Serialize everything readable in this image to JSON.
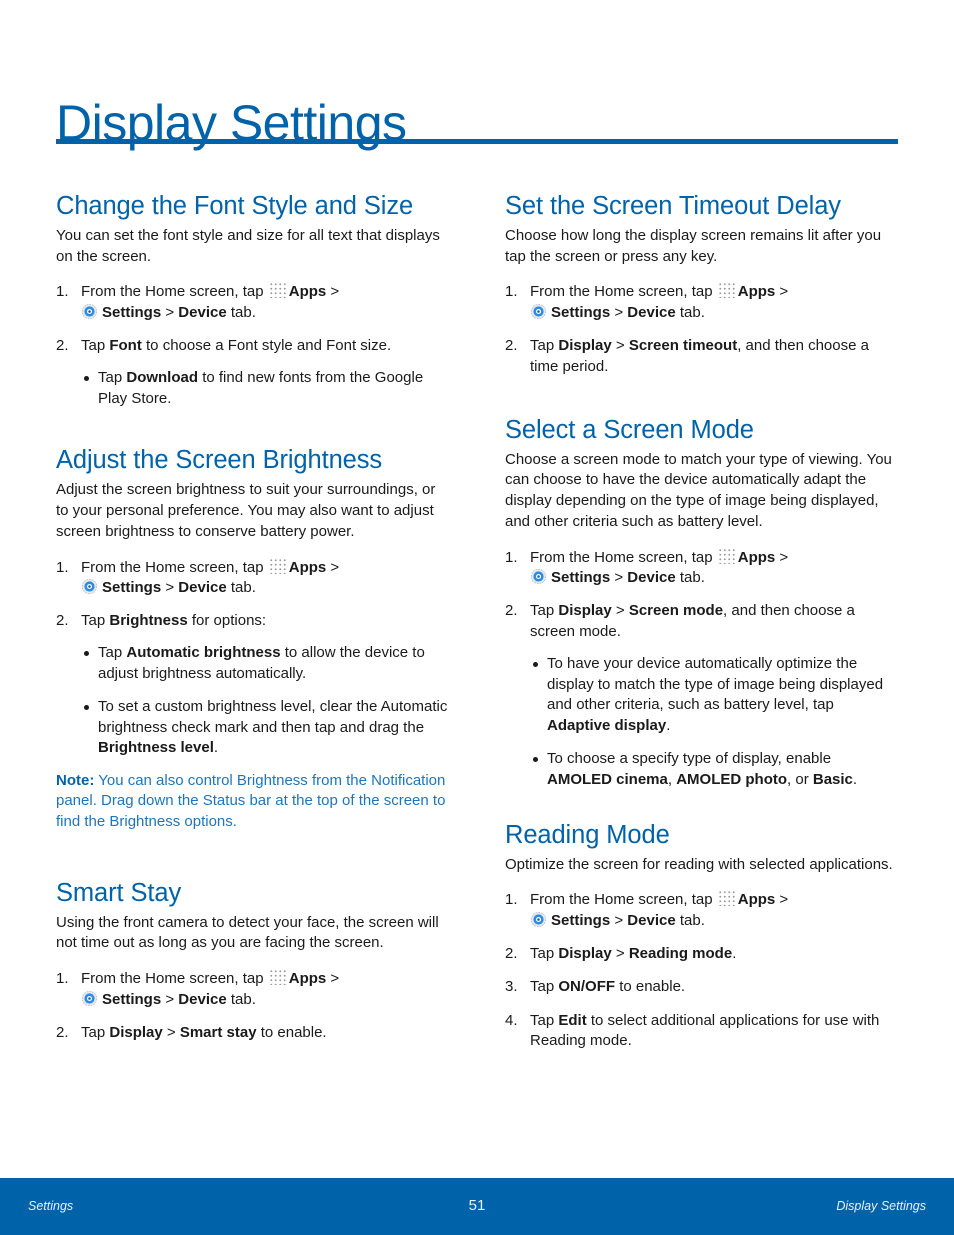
{
  "page": {
    "title": "Display Settings",
    "accent_color": "#0062a8"
  },
  "common": {
    "step1_a": "From the Home screen, tap ",
    "apps": "Apps",
    "sep": " > ",
    "settings": "Settings",
    "device": "Device",
    "tab": " tab.",
    "apps_icon": "apps-grid-icon",
    "settings_icon": "settings-gear-icon"
  },
  "sections": {
    "font": {
      "heading": "Change the Font Style and Size",
      "intro": "You can set the font style and size for all text that displays on the screen.",
      "step2_a": "Tap ",
      "step2_b": "Font",
      "step2_c": " to choose a Font style and Font size.",
      "bullet1_a": "Tap ",
      "bullet1_b": "Download",
      "bullet1_c": " to find new fonts from the Google Play Store."
    },
    "brightness": {
      "heading": "Adjust the Screen Brightness",
      "intro": "Adjust the screen brightness to suit your surroundings, or to your personal preference. You may also want to adjust screen brightness to conserve battery power.",
      "step2_a": "Tap ",
      "step2_b": "Brightness",
      "step2_c": " for options:",
      "bullet1_a": "Tap ",
      "bullet1_b": "Automatic brightness",
      "bullet1_c": " to allow the device to adjust brightness automatically.",
      "bullet2_a": "To set a custom brightness level, clear the Automatic brightness check mark and then tap and drag the ",
      "bullet2_b": "Brightness level",
      "bullet2_c": ".",
      "note_label": "Note:",
      "note_text": " You can also control Brightness from the Notification panel. Drag down the Status bar at the top of the screen to find the Brightness options."
    },
    "smart_stay": {
      "heading": "Smart Stay",
      "intro": "Using the front camera to detect your face, the screen will not time out as long as you are facing the screen.",
      "step2_a": "Tap ",
      "step2_b": "Display",
      "step2_c": " > ",
      "step2_d": "Smart stay",
      "step2_e": " to enable."
    },
    "timeout": {
      "heading": "Set the Screen Timeout Delay",
      "intro": "Choose how long the display screen remains lit after you tap the screen or press any key.",
      "step2_a": "Tap ",
      "step2_b": "Display",
      "step2_c": " > ",
      "step2_d": "Screen timeout",
      "step2_e": ", and then choose a time period."
    },
    "screen_mode": {
      "heading": "Select a Screen Mode",
      "intro": "Choose a screen mode to match your type of viewing. You can choose to have the device automatically adapt the display depending on the type of image being displayed, and other criteria such as battery level.",
      "step2_a": "Tap ",
      "step2_b": "Display",
      "step2_c": " > ",
      "step2_d": "Screen mode",
      "step2_e": ", and then choose a screen mode.",
      "bullet1_a": "To have your device automatically optimize the display to match the type of image being displayed and other criteria, such as battery level, tap ",
      "bullet1_b": "Adaptive display",
      "bullet1_c": ".",
      "bullet2_a": "To choose a specify type of display, enable ",
      "bullet2_b": "AMOLED cinema",
      "bullet2_c": ", ",
      "bullet2_d": "AMOLED photo",
      "bullet2_e": ", or ",
      "bullet2_f": "Basic",
      "bullet2_g": "."
    },
    "reading": {
      "heading": "Reading Mode",
      "intro": "Optimize the screen for reading with selected applications.",
      "step2_a": "Tap ",
      "step2_b": "Display",
      "step2_c": " > ",
      "step2_d": "Reading mode",
      "step2_e": ".",
      "step3_a": "Tap ",
      "step3_b": "ON/OFF",
      "step3_c": " to enable.",
      "step4_a": "Tap ",
      "step4_b": "Edit",
      "step4_c": " to select additional applications for use with Reading mode."
    }
  },
  "nums": {
    "n1": "1.",
    "n2": "2.",
    "n3": "3.",
    "n4": "4."
  },
  "footer": {
    "left": "Settings",
    "page_number": "51",
    "right": "Display Settings"
  }
}
